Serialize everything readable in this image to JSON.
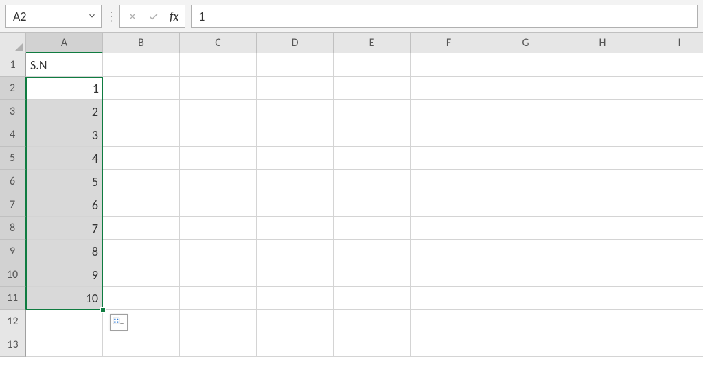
{
  "formula_bar": {
    "name_box": "A2",
    "formula_value": "1"
  },
  "columns": [
    "A",
    "B",
    "C",
    "D",
    "E",
    "F",
    "G",
    "H",
    "I"
  ],
  "selected_column_index": 0,
  "rows": [
    "1",
    "2",
    "3",
    "4",
    "5",
    "6",
    "7",
    "8",
    "9",
    "10",
    "11",
    "12",
    "13"
  ],
  "selected_row_start": 1,
  "selected_row_end": 10,
  "cell_data": {
    "A1": "S.N",
    "A2": "1",
    "A3": "2",
    "A4": "3",
    "A5": "4",
    "A6": "5",
    "A7": "6",
    "A8": "7",
    "A9": "8",
    "A10": "9",
    "A11": "10"
  }
}
